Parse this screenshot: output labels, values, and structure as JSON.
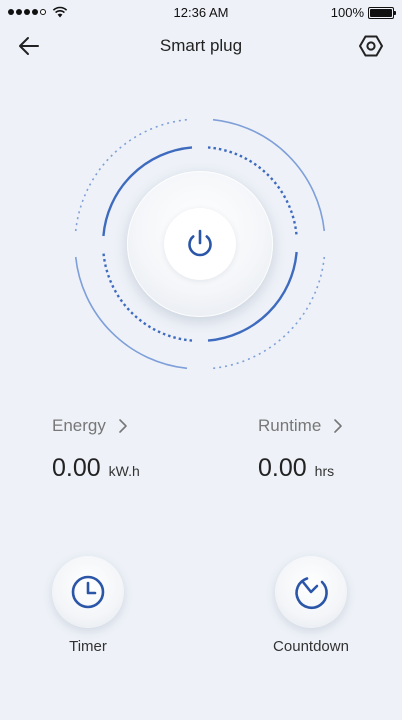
{
  "status_bar": {
    "time": "12:36 AM",
    "battery": "100%",
    "signal_dots": 5
  },
  "nav": {
    "title": "Smart plug",
    "back_icon": "arrow-left-icon",
    "settings_icon": "hexagon-gear-icon"
  },
  "power": {
    "icon": "power-icon",
    "accent_color": "#2b56a8",
    "ring_color": "#3f6bbf"
  },
  "stats": {
    "energy": {
      "label": "Energy",
      "value": "0.00",
      "unit": "kW.h"
    },
    "runtime": {
      "label": "Runtime",
      "value": "0.00",
      "unit": "hrs"
    }
  },
  "actions": {
    "timer": {
      "label": "Timer",
      "icon": "clock-icon"
    },
    "countdown": {
      "label": "Countdown",
      "icon": "countdown-timer-icon"
    }
  }
}
